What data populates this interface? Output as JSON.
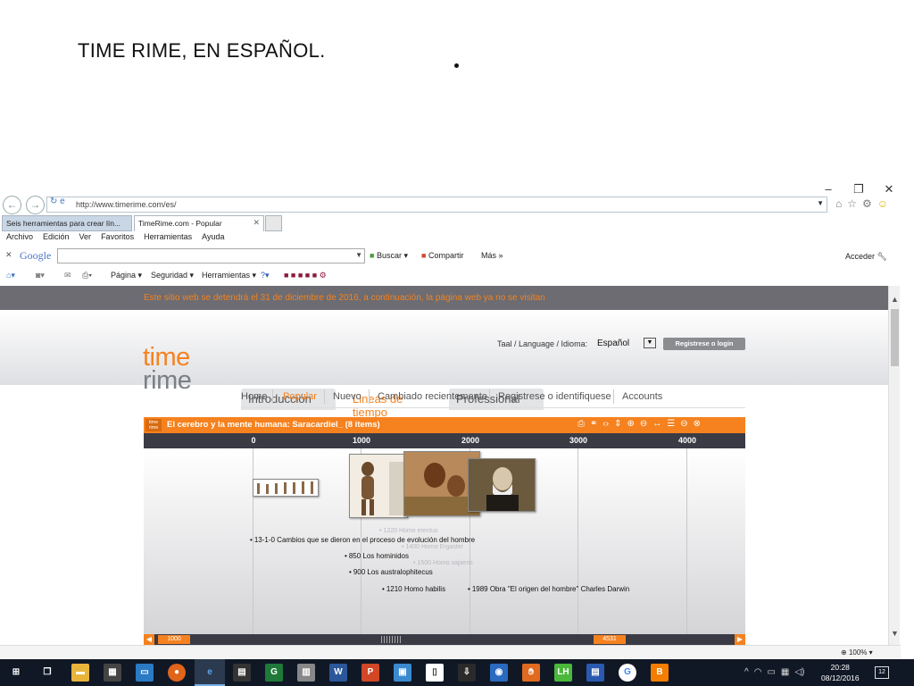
{
  "slide": {
    "title": "TIME RIME, EN ESPAÑOL."
  },
  "browser": {
    "window_controls": {
      "minimize": "–",
      "restore": "❐",
      "close": "✕"
    },
    "url": "http://www.timerime.com/es/",
    "tabs": [
      {
        "label": "Seis herramientas para crear lín..."
      },
      {
        "label": "TimeRime.com - Popular",
        "close": "✕"
      }
    ],
    "menu": [
      "Archivo",
      "Edición",
      "Ver",
      "Favoritos",
      "Herramientas",
      "Ayuda"
    ],
    "google_toolbar": {
      "logo": "Google",
      "search_placeholder": "",
      "buscar": "Buscar",
      "compartir": "Compartir",
      "mas": "Más »",
      "acceder": "Acceder"
    },
    "command_bar": {
      "pagina": "Página",
      "seguridad": "Seguridad",
      "herramientas": "Herramientas"
    },
    "zoom": "100%"
  },
  "site": {
    "notice": "Este sitio web se detendrá el 31 de diciembre de 2016, a continuación, la página web ya no se visitan",
    "logo_top": "time",
    "logo_bottom": "rime",
    "language_label": "Taal / Language / Idioma:",
    "language_value": "Español",
    "login_button": "Registrese o login",
    "main_tabs": [
      "Introducción",
      "Lineas de tiempo",
      "Professional"
    ],
    "sub_nav": [
      "Home",
      "Popular",
      "Nuevo",
      "Cambiado recientemente",
      "Registrese o identifiquese",
      "Accounts"
    ]
  },
  "timeline": {
    "logo": "time rime",
    "title": "El cerebro y la mente humana: Saracardiel_  (8 items)",
    "ticks": [
      "0",
      "1000",
      "2000",
      "3000",
      "4000"
    ],
    "events": [
      {
        "text": "1220 Homo erectus",
        "faded": true
      },
      {
        "text": "13-1-0 Cambios que se dieron en el proceso de evolución del hombre",
        "faded": false
      },
      {
        "text": "1400 Homo Ergaster",
        "faded": true
      },
      {
        "text": "850 Los hominidos",
        "faded": false
      },
      {
        "text": "1500 Homo sapiens",
        "faded": true
      },
      {
        "text": "900 Los australophitecus",
        "faded": false
      },
      {
        "text": "1210 Homo habilis",
        "faded": false
      },
      {
        "text": "1989 Obra \"El origen del hombre\" Charles Darwin",
        "faded": false
      }
    ],
    "range_start": "1000",
    "range_end": "4531"
  },
  "taskbar": {
    "clock_time": "20:28",
    "clock_date": "08/12/2016",
    "notifications": "12"
  }
}
